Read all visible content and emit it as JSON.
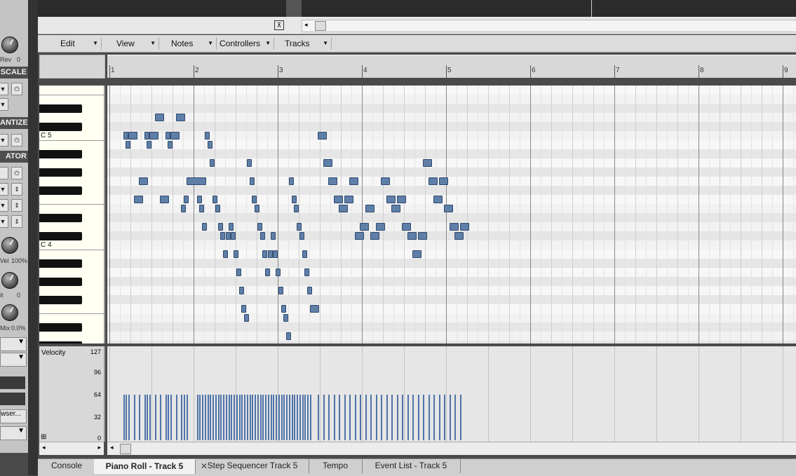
{
  "left_panel": {
    "rev_label": "Rev",
    "rev_value": "0",
    "scale_label": "SCALE",
    "quantize_label": "ANTIZE",
    "generator_label": "ATOR",
    "vel_label": "Vel",
    "vel_value": "100%",
    "it_label": "it",
    "it_value": "0",
    "mix_label": "Mix",
    "mix_value": "0.0%",
    "browser_label": "wser...",
    "power_icon": "power-icon"
  },
  "menu": {
    "items": [
      "Edit",
      "View",
      "Notes",
      "Controllers",
      "Tracks"
    ]
  },
  "ruler": {
    "bars": [
      "1",
      "2",
      "3",
      "4",
      "5",
      "6",
      "7",
      "8",
      "9"
    ]
  },
  "keyboard": {
    "c5_label": "C 5",
    "c4_label": "C 4"
  },
  "velocity": {
    "label": "Velocity",
    "ticks": [
      "127",
      "96",
      "64",
      "32",
      "0"
    ],
    "value": 64
  },
  "tabs": [
    {
      "label": "Console",
      "active": false
    },
    {
      "label": "Piano Roll - Track 5",
      "active": true,
      "closable": true
    },
    {
      "label": "Step Sequencer Track 5",
      "active": false
    },
    {
      "label": "Tempo",
      "active": false
    },
    {
      "label": "Event List - Track 5",
      "active": false
    }
  ],
  "colors": {
    "note_fill": "#5f7fa8",
    "note_border": "#2f4a6f",
    "velocity_bar": "#4f73a8"
  },
  "chart_data": {
    "type": "piano-roll",
    "notes": [
      {
        "beat": 0.25,
        "len": 0.125,
        "pitch": "C5"
      },
      {
        "beat": 0.375,
        "len": 0.125,
        "pitch": "B4"
      },
      {
        "beat": 0.5,
        "len": 0.25,
        "pitch": "C5"
      },
      {
        "beat": 0.75,
        "len": 0.25,
        "pitch": "F4"
      },
      {
        "beat": 1.0,
        "len": 0.25,
        "pitch": "G4"
      },
      {
        "beat": 1.25,
        "len": 0.125,
        "pitch": "C5"
      },
      {
        "beat": 1.375,
        "len": 0.125,
        "pitch": "B4"
      },
      {
        "beat": 1.5,
        "len": 0.25,
        "pitch": "C5"
      },
      {
        "beat": 1.75,
        "len": 0.25,
        "pitch": "D5"
      },
      {
        "beat": 2.0,
        "len": 0.25,
        "pitch": "F4"
      },
      {
        "beat": 2.25,
        "len": 0.125,
        "pitch": "C5"
      },
      {
        "beat": 2.375,
        "len": 0.125,
        "pitch": "B4"
      },
      {
        "beat": 2.5,
        "len": 0.25,
        "pitch": "C5"
      },
      {
        "beat": 2.75,
        "len": 0.25,
        "pitch": "D5"
      },
      {
        "beat": 3.0,
        "len": 0.125,
        "pitch": "E4"
      },
      {
        "beat": 3.125,
        "len": 0.125,
        "pitch": "F4"
      },
      {
        "beat": 3.25,
        "len": 0.5,
        "pitch": "G4"
      },
      {
        "beat": 3.75,
        "len": 0.125,
        "pitch": "F4"
      },
      {
        "beat": 3.875,
        "len": 0.125,
        "pitch": "E4"
      },
      {
        "beat": 4.0,
        "len": 0.125,
        "pitch": "D4"
      },
      {
        "beat": 4.125,
        "len": 0.125,
        "pitch": "C5"
      },
      {
        "beat": 4.25,
        "len": 0.125,
        "pitch": "B4"
      },
      {
        "beat": 4.375,
        "len": 0.125,
        "pitch": "A4"
      },
      {
        "beat": 4.5,
        "len": 0.125,
        "pitch": "F4"
      },
      {
        "beat": 4.625,
        "len": 0.125,
        "pitch": "E4"
      },
      {
        "beat": 4.75,
        "len": 0.125,
        "pitch": "D4"
      },
      {
        "beat": 4.875,
        "len": 0.125,
        "pitch": "C#4"
      },
      {
        "beat": 5.0,
        "len": 0.125,
        "pitch": "B3"
      },
      {
        "beat": 5.125,
        "len": 0.125,
        "pitch": "C#4"
      },
      {
        "beat": 5.25,
        "len": 0.125,
        "pitch": "D4"
      },
      {
        "beat": 5.375,
        "len": 0.125,
        "pitch": "C#4"
      },
      {
        "beat": 5.5,
        "len": 0.125,
        "pitch": "B3"
      },
      {
        "beat": 5.625,
        "len": 0.125,
        "pitch": "A3"
      },
      {
        "beat": 5.75,
        "len": 0.125,
        "pitch": "G3"
      },
      {
        "beat": 5.875,
        "len": 0.125,
        "pitch": "F3"
      },
      {
        "beat": 6.0,
        "len": 0.125,
        "pitch": "E3"
      },
      {
        "beat": 6.125,
        "len": 0.125,
        "pitch": "A4"
      },
      {
        "beat": 6.25,
        "len": 0.125,
        "pitch": "G4"
      },
      {
        "beat": 6.375,
        "len": 0.125,
        "pitch": "F4"
      },
      {
        "beat": 6.5,
        "len": 0.125,
        "pitch": "E4"
      },
      {
        "beat": 6.625,
        "len": 0.125,
        "pitch": "D4"
      },
      {
        "beat": 6.75,
        "len": 0.125,
        "pitch": "C#4"
      },
      {
        "beat": 6.875,
        "len": 0.125,
        "pitch": "B3"
      },
      {
        "beat": 7.0,
        "len": 0.125,
        "pitch": "A3"
      },
      {
        "beat": 7.125,
        "len": 0.125,
        "pitch": "B3"
      },
      {
        "beat": 7.25,
        "len": 0.125,
        "pitch": "C#4"
      },
      {
        "beat": 7.375,
        "len": 0.125,
        "pitch": "B3"
      },
      {
        "beat": 7.5,
        "len": 0.125,
        "pitch": "A3"
      },
      {
        "beat": 7.625,
        "len": 0.125,
        "pitch": "G3"
      },
      {
        "beat": 7.75,
        "len": 0.125,
        "pitch": "F3"
      },
      {
        "beat": 7.875,
        "len": 0.125,
        "pitch": "E3"
      },
      {
        "beat": 8.0,
        "len": 0.125,
        "pitch": "D3"
      },
      {
        "beat": 8.125,
        "len": 0.125,
        "pitch": "G4"
      },
      {
        "beat": 8.25,
        "len": 0.125,
        "pitch": "F4"
      },
      {
        "beat": 8.375,
        "len": 0.125,
        "pitch": "E4"
      },
      {
        "beat": 8.5,
        "len": 0.125,
        "pitch": "D4"
      },
      {
        "beat": 8.625,
        "len": 0.125,
        "pitch": "C#4"
      },
      {
        "beat": 8.75,
        "len": 0.125,
        "pitch": "B3"
      },
      {
        "beat": 8.875,
        "len": 0.125,
        "pitch": "A3"
      },
      {
        "beat": 9.0,
        "len": 0.125,
        "pitch": "G3"
      },
      {
        "beat": 9.125,
        "len": 0.25,
        "pitch": "F3"
      },
      {
        "beat": 9.5,
        "len": 0.25,
        "pitch": "C5"
      },
      {
        "beat": 9.75,
        "len": 0.25,
        "pitch": "A4"
      },
      {
        "beat": 10.0,
        "len": 0.25,
        "pitch": "G4"
      },
      {
        "beat": 10.25,
        "len": 0.25,
        "pitch": "F4"
      },
      {
        "beat": 10.5,
        "len": 0.25,
        "pitch": "E4"
      },
      {
        "beat": 10.75,
        "len": 0.25,
        "pitch": "F4"
      },
      {
        "beat": 11.0,
        "len": 0.25,
        "pitch": "G4"
      },
      {
        "beat": 11.25,
        "len": 0.25,
        "pitch": "C#4"
      },
      {
        "beat": 11.5,
        "len": 0.25,
        "pitch": "D4"
      },
      {
        "beat": 11.75,
        "len": 0.25,
        "pitch": "E4"
      },
      {
        "beat": 12.0,
        "len": 0.25,
        "pitch": "C#4"
      },
      {
        "beat": 12.25,
        "len": 0.25,
        "pitch": "D4"
      },
      {
        "beat": 12.5,
        "len": 0.25,
        "pitch": "G4"
      },
      {
        "beat": 12.75,
        "len": 0.25,
        "pitch": "F4"
      },
      {
        "beat": 13.0,
        "len": 0.25,
        "pitch": "E4"
      },
      {
        "beat": 13.25,
        "len": 0.25,
        "pitch": "F4"
      },
      {
        "beat": 13.5,
        "len": 0.25,
        "pitch": "D4"
      },
      {
        "beat": 13.75,
        "len": 0.25,
        "pitch": "C#4"
      },
      {
        "beat": 14.0,
        "len": 0.25,
        "pitch": "B3"
      },
      {
        "beat": 14.25,
        "len": 0.25,
        "pitch": "C#4"
      },
      {
        "beat": 14.5,
        "len": 0.25,
        "pitch": "A4"
      },
      {
        "beat": 14.75,
        "len": 0.25,
        "pitch": "G4"
      },
      {
        "beat": 15.0,
        "len": 0.25,
        "pitch": "F4"
      },
      {
        "beat": 15.25,
        "len": 0.25,
        "pitch": "G4"
      },
      {
        "beat": 15.5,
        "len": 0.25,
        "pitch": "E4"
      },
      {
        "beat": 15.75,
        "len": 0.25,
        "pitch": "D4"
      },
      {
        "beat": 16.0,
        "len": 0.25,
        "pitch": "C#4"
      },
      {
        "beat": 16.25,
        "len": 0.25,
        "pitch": "D4"
      }
    ]
  }
}
